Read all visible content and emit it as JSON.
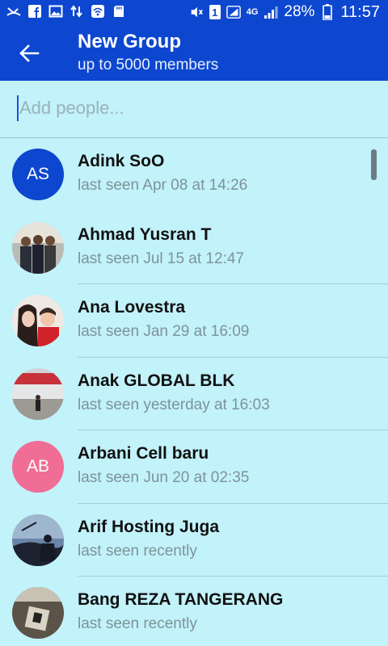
{
  "statusbar": {
    "sim_badge": "1",
    "network": "4G",
    "battery": "28%",
    "time": "11:57"
  },
  "header": {
    "title": "New Group",
    "subtitle": "up to 5000 members"
  },
  "search": {
    "placeholder": "Add people..."
  },
  "colors": {
    "brand": "#0d47cf",
    "background": "#c2f2fa",
    "avatar_as": "#0d47cf",
    "avatar_ab": "#f06d96"
  },
  "contacts": [
    {
      "name": "Adink SoO",
      "status": "last seen Apr 08 at 14:26",
      "initials": "AS"
    },
    {
      "name": "Ahmad Yusran T",
      "status": "last seen Jul 15 at 12:47"
    },
    {
      "name": "Ana Lovestra",
      "status": "last seen Jan 29 at 16:09"
    },
    {
      "name": "Anak GLOBAL BLK",
      "status": "last seen yesterday at 16:03"
    },
    {
      "name": "Arbani Cell baru",
      "status": "last seen Jun 20 at 02:35",
      "initials": "AB"
    },
    {
      "name": "Arif Hosting Juga",
      "status": "last seen recently"
    },
    {
      "name": "Bang REZA TANGERANG",
      "status": "last seen recently"
    }
  ]
}
